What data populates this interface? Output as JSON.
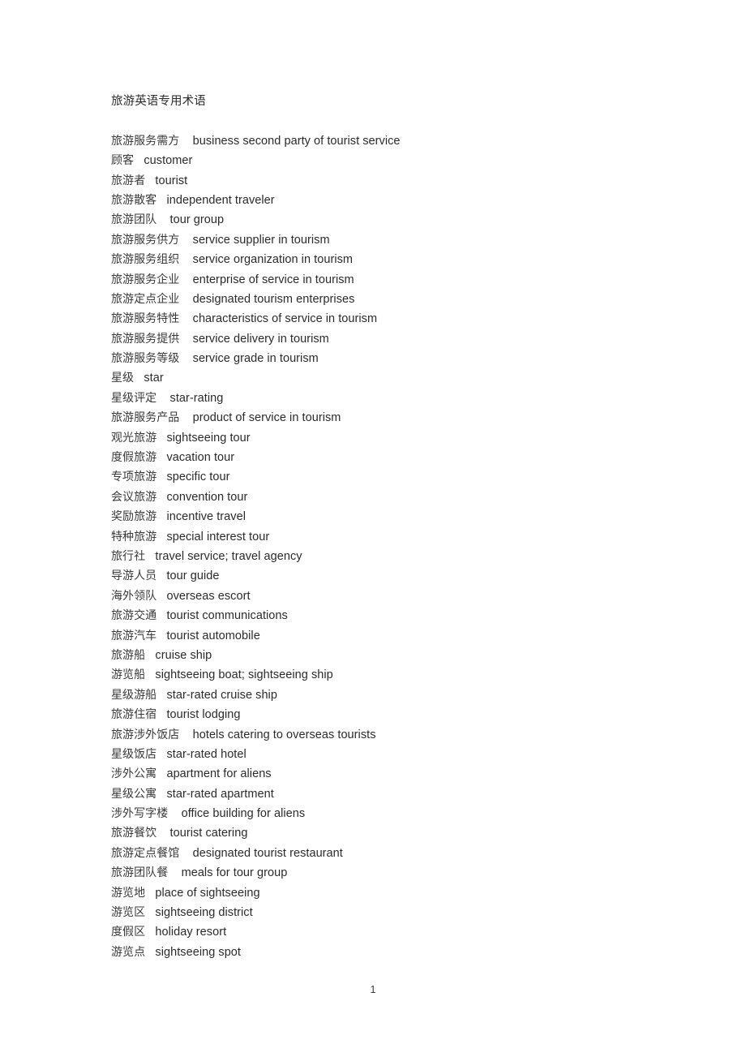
{
  "document": {
    "title": "旅游英语专用术语",
    "page_number": "1",
    "text_color": "#2b2b2b",
    "background_color": "#ffffff"
  },
  "glossary": {
    "entries": [
      {
        "cn": "旅游服务需方",
        "gap": "    ",
        "en": "business second party of tourist service"
      },
      {
        "cn": "顾客",
        "gap": "   ",
        "en": "customer"
      },
      {
        "cn": "旅游者",
        "gap": "   ",
        "en": "tourist"
      },
      {
        "cn": "旅游散客",
        "gap": "   ",
        "en": "independent traveler"
      },
      {
        "cn": "旅游团队",
        "gap": "    ",
        "en": "tour group"
      },
      {
        "cn": "旅游服务供方",
        "gap": "    ",
        "en": "service supplier in tourism"
      },
      {
        "cn": "旅游服务组织",
        "gap": "    ",
        "en": "service organization in tourism"
      },
      {
        "cn": "旅游服务企业",
        "gap": "    ",
        "en": "enterprise of service in tourism"
      },
      {
        "cn": "旅游定点企业",
        "gap": "    ",
        "en": "designated tourism enterprises"
      },
      {
        "cn": "旅游服务特性",
        "gap": "    ",
        "en": "characteristics of service in tourism"
      },
      {
        "cn": "旅游服务提供",
        "gap": "    ",
        "en": "service delivery in tourism"
      },
      {
        "cn": "旅游服务等级",
        "gap": "    ",
        "en": "service grade in tourism"
      },
      {
        "cn": "星级",
        "gap": "   ",
        "en": "star"
      },
      {
        "cn": "星级评定",
        "gap": "    ",
        "en": "star-rating"
      },
      {
        "cn": "旅游服务产品",
        "gap": "    ",
        "en": "product of service in tourism"
      },
      {
        "cn": "观光旅游",
        "gap": "   ",
        "en": "sightseeing tour"
      },
      {
        "cn": "度假旅游",
        "gap": "   ",
        "en": "vacation tour"
      },
      {
        "cn": "专项旅游",
        "gap": "   ",
        "en": "specific tour"
      },
      {
        "cn": "会议旅游",
        "gap": "   ",
        "en": "convention tour"
      },
      {
        "cn": "奖励旅游",
        "gap": "   ",
        "en": "incentive travel"
      },
      {
        "cn": "特种旅游",
        "gap": "   ",
        "en": "special interest tour"
      },
      {
        "cn": "旅行社",
        "gap": "   ",
        "en": "travel service; travel agency"
      },
      {
        "cn": "导游人员",
        "gap": "   ",
        "en": "tour guide"
      },
      {
        "cn": "海外领队",
        "gap": "   ",
        "en": "overseas escort"
      },
      {
        "cn": "旅游交通",
        "gap": "   ",
        "en": "tourist communications"
      },
      {
        "cn": "旅游汽车",
        "gap": "   ",
        "en": "tourist automobile"
      },
      {
        "cn": "旅游船",
        "gap": "   ",
        "en": "cruise ship"
      },
      {
        "cn": "游览船",
        "gap": "   ",
        "en": "sightseeing boat; sightseeing ship"
      },
      {
        "cn": "星级游船",
        "gap": "   ",
        "en": "star-rated cruise ship"
      },
      {
        "cn": "旅游住宿",
        "gap": "   ",
        "en": "tourist lodging"
      },
      {
        "cn": "旅游涉外饭店",
        "gap": "    ",
        "en": "hotels catering to overseas tourists"
      },
      {
        "cn": "星级饭店",
        "gap": "   ",
        "en": "star-rated hotel"
      },
      {
        "cn": "涉外公寓",
        "gap": "   ",
        "en": "apartment for aliens"
      },
      {
        "cn": "星级公寓",
        "gap": "   ",
        "en": "star-rated apartment"
      },
      {
        "cn": "涉外写字楼",
        "gap": "    ",
        "en": "office building for aliens"
      },
      {
        "cn": "旅游餐饮",
        "gap": "    ",
        "en": "tourist catering"
      },
      {
        "cn": "旅游定点餐馆",
        "gap": "    ",
        "en": "designated tourist restaurant"
      },
      {
        "cn": "旅游团队餐",
        "gap": "    ",
        "en": "meals for tour group"
      },
      {
        "cn": "游览地",
        "gap": "   ",
        "en": "place of sightseeing"
      },
      {
        "cn": "游览区",
        "gap": "   ",
        "en": "sightseeing district"
      },
      {
        "cn": "度假区",
        "gap": "   ",
        "en": "holiday resort"
      },
      {
        "cn": "游览点",
        "gap": "   ",
        "en": "sightseeing spot"
      }
    ]
  }
}
